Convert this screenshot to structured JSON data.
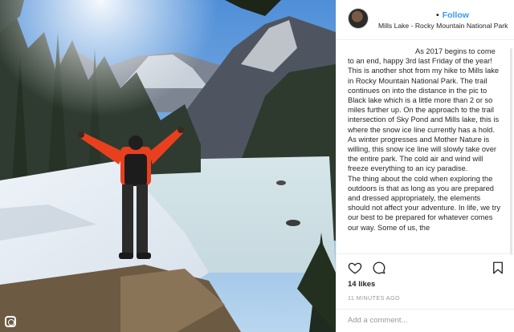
{
  "post": {
    "location": "Mills Lake - Rocky Mountain National Park",
    "follow_label": "Follow",
    "follow_separator": "•",
    "caption": [
      "As 2017 begins to come to an end, happy 3rd last Friday of the year! This is another shot from my hike to Mills lake in Rocky Mountain National Park. The trail continues on into the distance in the pic to Black lake which is a little more than 2 or so miles further up. On the approach to the trail intersection of Sky Pond and Mills lake, this is where the snow ice line currently has a hold. As winter progresses and Mother Nature is willing, this snow ice line will slowly take over the entire park. The cold air and wind will freeze everything to an icy paradise.",
      "The thing about the cold when exploring the outdoors is that as long as you are prepared and dressed appropriately, the elements should not affect your adventure. In life, we try our best to be prepared for whatever comes our way. Some of us, the"
    ],
    "likes": "14 likes",
    "time": "11 MINUTES AGO",
    "comment_placeholder": "Add a comment..."
  },
  "icons": {
    "heart": "heart-icon",
    "comment": "comment-icon",
    "save": "bookmark-icon",
    "instagram": "instagram-icon"
  },
  "colors": {
    "link_blue": "#3897f0",
    "text": "#262626",
    "muted": "#999999",
    "jacket_red": "#e8401f"
  }
}
